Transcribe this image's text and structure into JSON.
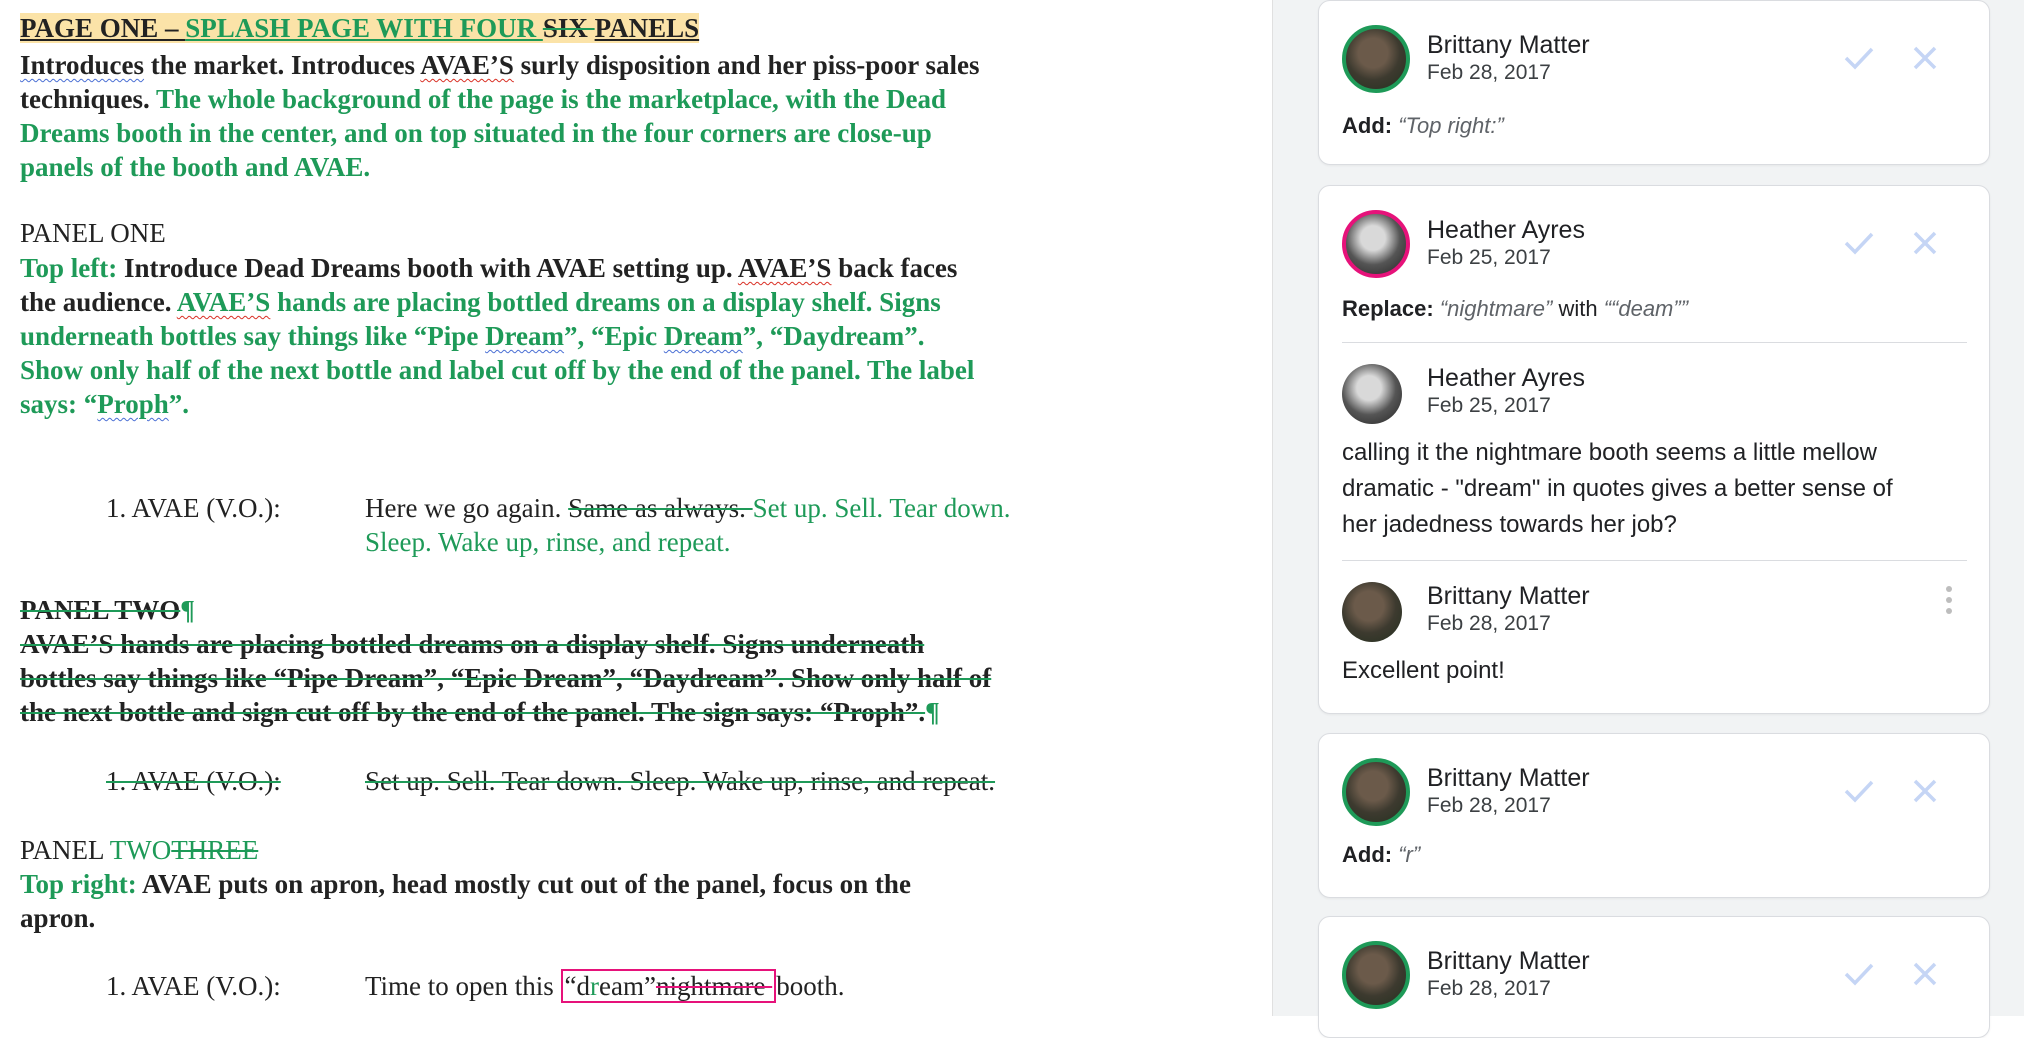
{
  "doc": {
    "heading": {
      "text1": "PAGE ONE – ",
      "ins1": "SPLASH PAGE WITH FOUR ",
      "del1": "SIX ",
      "text2": "PANELS"
    },
    "intro": {
      "w1": "Introduces",
      "t1": " the market. Introduces ",
      "w2": "AVAE’S",
      "t2": " surly disposition and her piss-poor sales",
      "t3": "techniques. ",
      "ins": "The whole background of the page is the marketplace, with the Dead",
      "ins2": "Dreams booth in the center, and on top situated in the four corners are close-up",
      "ins3": "panels of the booth and AVAE."
    },
    "panel1": {
      "title": "PANEL ONE",
      "ins_label": "Top left:",
      "t1": " Introduce Dead Dreams booth with AVAE setting up. ",
      "w1": "AVAE’S",
      "t2": " back faces",
      "t3": "the audience. ",
      "g1": "AVAE’S",
      "g2": " hands are placing bottled dreams on a display shelf. Signs",
      "g3": "underneath bottles say things like “Pipe ",
      "g3w": "Dream",
      "g3b": "”, “Epic ",
      "g3w2": "Dream",
      "g3c": "”, “Daydream”.",
      "g4": "Show only half of the next bottle and label cut off by the end of the panel. The label",
      "g5": "says: “",
      "g5w": "Proph",
      "g5b": "”."
    },
    "dialogue1": {
      "speaker": "1. AVAE (V.O.):",
      "t1": "Here we go again. ",
      "del": "Same as always. ",
      "ins": "Set up. Sell. Tear down.",
      "ins2": "Sleep. Wake up, rinse, and repeat."
    },
    "panel2_deleted": {
      "title": "PANEL TWO",
      "pilcrow": "¶",
      "l1": "AVAE’S hands are placing bottled dreams on a display shelf. Signs underneath",
      "l2": "bottles say things like “Pipe Dream”, “Epic Dream”, “Daydream”. Show only half of",
      "l3": "the next bottle and sign cut off by the end of the panel. The sign says: “Proph”.",
      "pilcrow2": "¶",
      "speaker": "1. AVAE (V.O.):",
      "line": "Set up. Sell. Tear down. Sleep. Wake up, rinse, and repeat."
    },
    "panel3": {
      "title": "PANEL ",
      "ins": "TWO",
      "del": "THREE",
      "ins_label": "Top right:",
      "t1": " AVAE puts on apron, head mostly cut out of the panel, focus on the",
      "t2": "apron."
    },
    "dialogue3": {
      "speaker": "1. AVAE (V.O.):",
      "t1": "Time to open this ",
      "s1": "“d",
      "s2": "r",
      "s3": "eam”",
      "del": "nightmare ",
      "t2": "booth."
    }
  },
  "comments": [
    {
      "author": "Brittany Matter",
      "date": "Feb 28, 2017",
      "action": "Add:",
      "value": "“Top right:”"
    },
    {
      "author": "Heather Ayres",
      "date": "Feb 25, 2017",
      "action": "Replace:",
      "value": "“nightmare”",
      "with": "with",
      "value2": "““deam””",
      "replies": [
        {
          "author": "Heather Ayres",
          "date": "Feb 25, 2017",
          "lines": [
            "calling it the nightmare booth seems a little mellow",
            "dramatic - \"dream\" in quotes gives a better sense of",
            "her jadedness towards her job?"
          ]
        },
        {
          "author": "Brittany Matter",
          "date": "Feb 28, 2017",
          "lines": [
            "Excellent point!"
          ]
        }
      ]
    },
    {
      "author": "Brittany Matter",
      "date": "Feb 28, 2017",
      "action": "Add:",
      "value": "“r”"
    },
    {
      "author": "Brittany Matter",
      "date": "Feb 28, 2017"
    }
  ],
  "colors": {
    "insert": "#1e9a58",
    "highlight": "#fbe3a8",
    "accent_pink": "#e6127a",
    "accept_icon": "#c5d5f5"
  },
  "icons": [
    "checkmark-icon",
    "close-icon",
    "more-vert-icon"
  ]
}
